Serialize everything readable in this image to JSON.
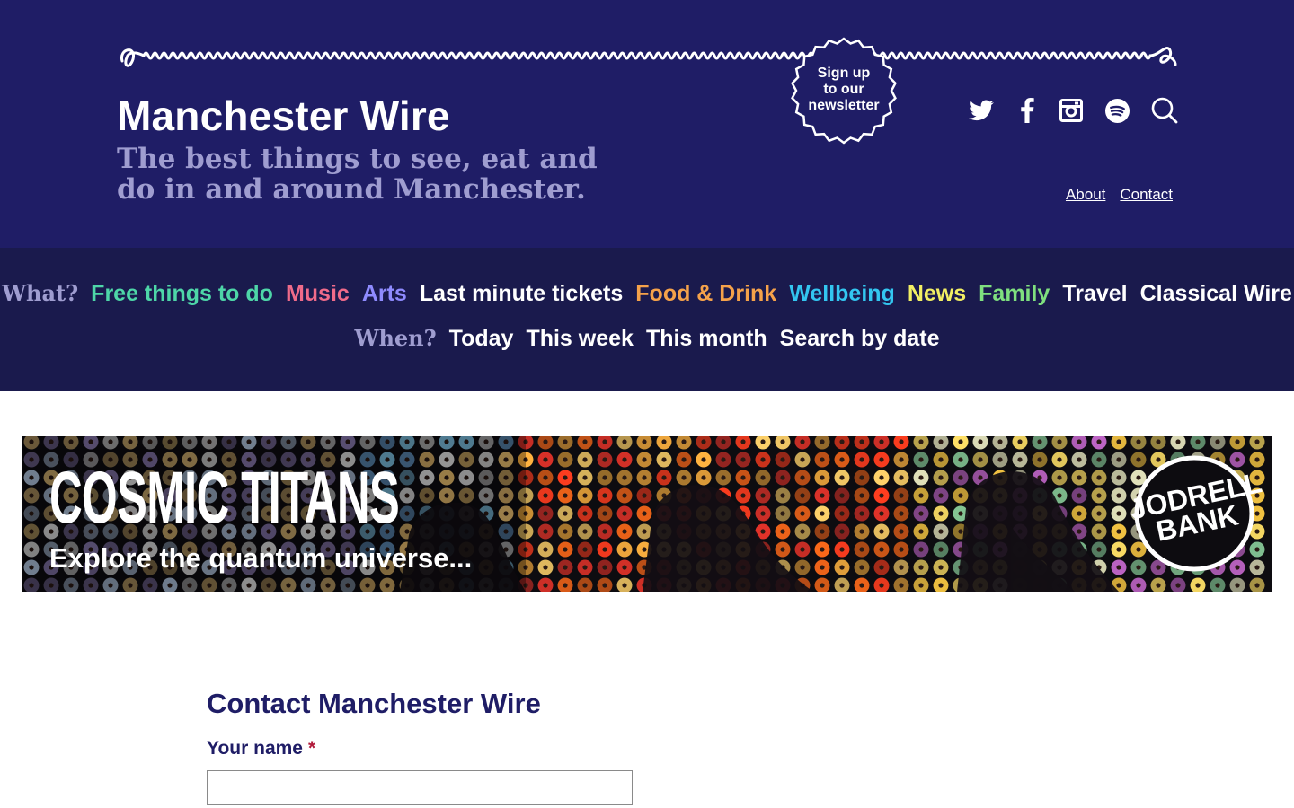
{
  "header": {
    "site_title": "Manchester Wire",
    "tagline": "The best things to see, eat and do in and around Manchester.",
    "newsletter_badge": "Sign up\nto our\nnewsletter",
    "social_icons": [
      "twitter-icon",
      "facebook-icon",
      "instagram-icon",
      "spotify-icon",
      "search-icon"
    ],
    "links": {
      "about": "About",
      "contact": "Contact"
    }
  },
  "nav": {
    "what_label": "What?",
    "what_items": [
      {
        "label": "Free things to do",
        "color": "#4ed6a8"
      },
      {
        "label": "Music",
        "color": "#f06b8a"
      },
      {
        "label": "Arts",
        "color": "#8f8bff"
      },
      {
        "label": "Last minute tickets",
        "color": "#ffffff"
      },
      {
        "label": "Food & Drink",
        "color": "#f5a24a"
      },
      {
        "label": "Wellbeing",
        "color": "#33c6f0"
      },
      {
        "label": "News",
        "color": "#f2ef63"
      },
      {
        "label": "Family",
        "color": "#7fe07f"
      },
      {
        "label": "Travel",
        "color": "#ffffff"
      },
      {
        "label": "Classical Wire",
        "color": "#ffffff"
      }
    ],
    "when_label": "When?",
    "when_items": [
      {
        "label": "Today",
        "color": "#ffffff"
      },
      {
        "label": "This week",
        "color": "#ffffff"
      },
      {
        "label": "This month",
        "color": "#ffffff"
      },
      {
        "label": "Search by date",
        "color": "#ffffff"
      }
    ]
  },
  "banner": {
    "title": "COSMIC TITANS",
    "subtitle": "Explore the quantum universe...",
    "logo_text": "JODRELL\nBANK"
  },
  "contact_form": {
    "title": "Contact Manchester Wire",
    "name_label": "Your name",
    "required_marker": "*",
    "name_value": ""
  },
  "colors": {
    "header_bg": "#1f1d66",
    "nav_bg": "#1a1a4d",
    "heading": "#1f1d66"
  }
}
